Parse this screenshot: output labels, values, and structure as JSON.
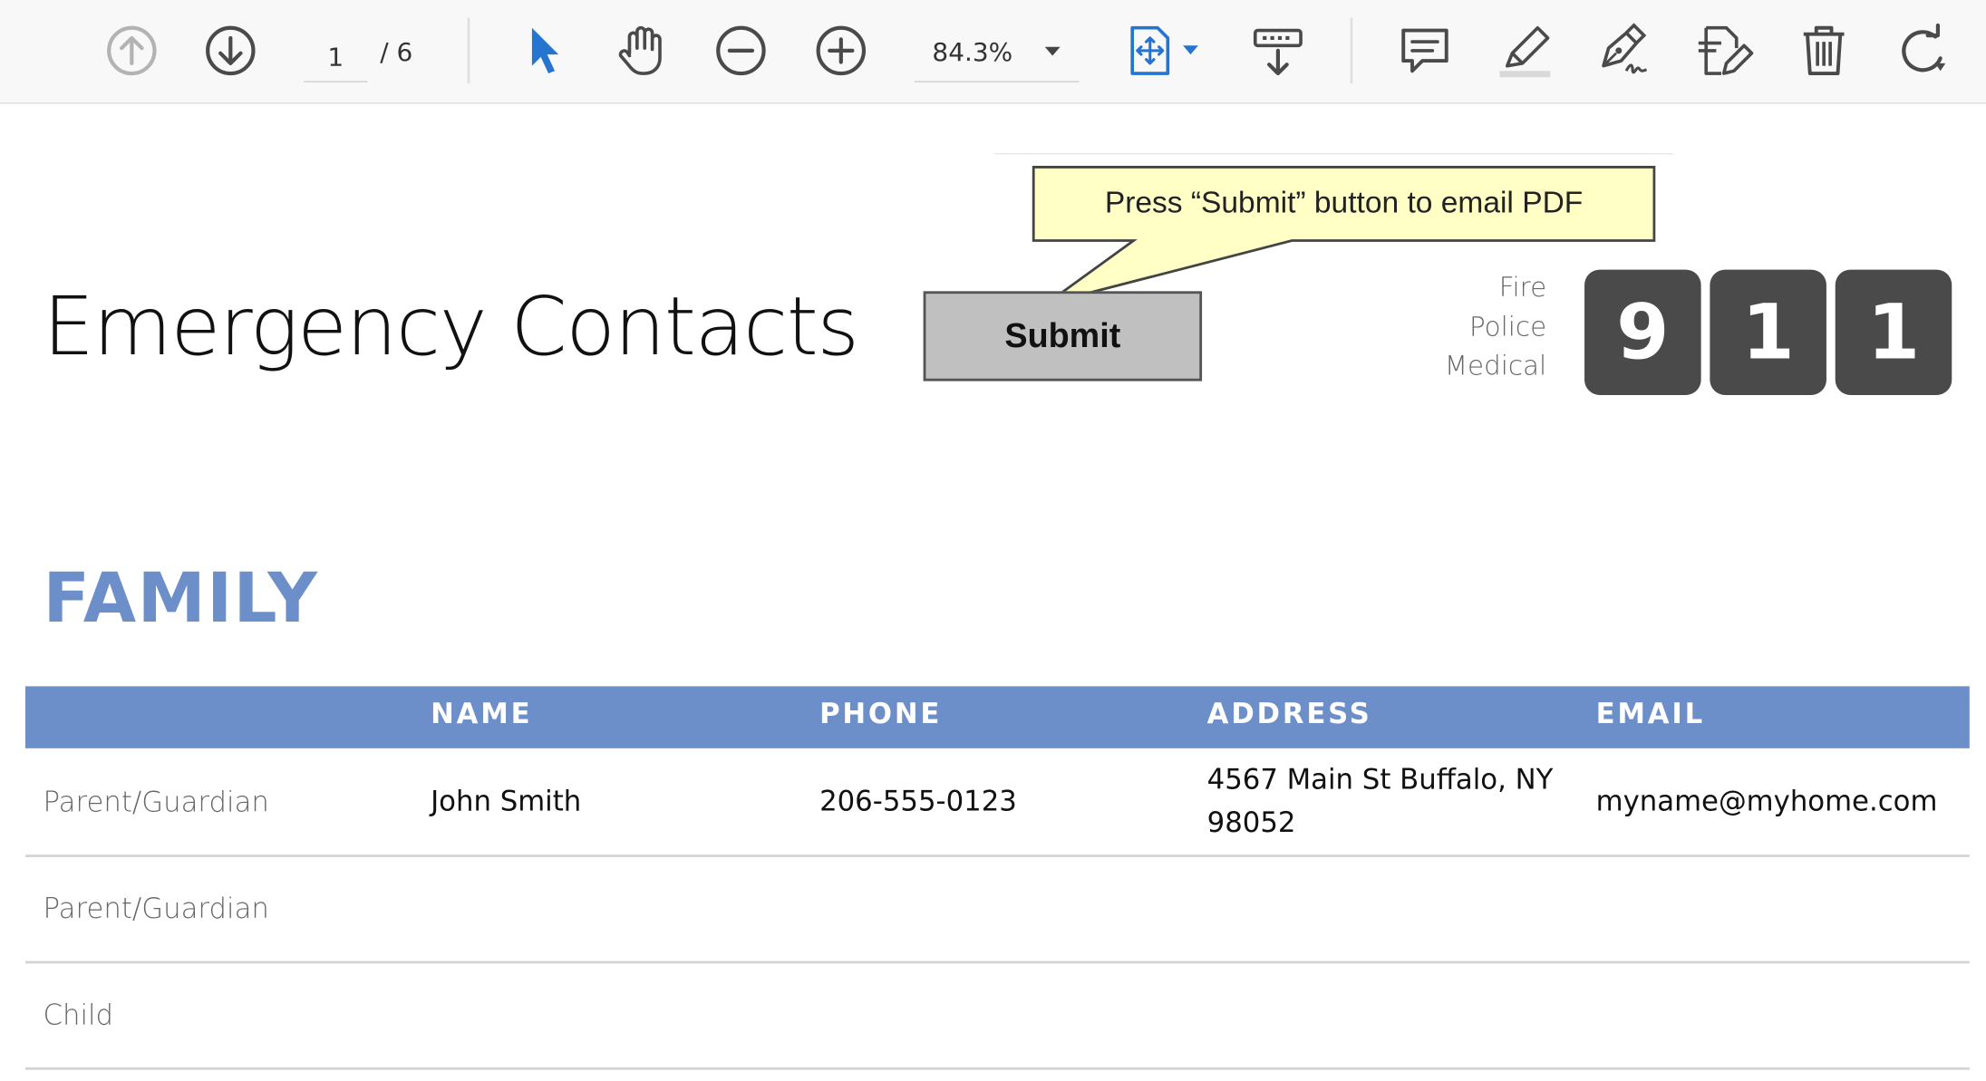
{
  "toolbar": {
    "page_current": "1",
    "page_total": "/ 6",
    "zoom": "84.3%",
    "icons": [
      "previous-page-icon",
      "next-page-icon",
      "select-arrow-icon",
      "hand-tool-icon",
      "zoom-out-icon",
      "zoom-in-icon",
      "fit-page-icon",
      "scroll-mode-icon",
      "comment-icon",
      "highlight-icon",
      "sign-icon",
      "edit-pdf-icon",
      "delete-icon",
      "rotate-icon"
    ]
  },
  "document": {
    "title": "Emergency Contacts",
    "submit_label": "Submit",
    "callout_text": "Press “Submit” button to email PDF",
    "services": [
      "Fire",
      "Police",
      "Medical"
    ],
    "emergency_number": [
      "9",
      "1",
      "1"
    ],
    "section_title": "FAMILY",
    "table": {
      "headers": [
        "NAME",
        "PHONE",
        "ADDRESS",
        "EMAIL"
      ],
      "rows": [
        {
          "label": "Parent/Guardian",
          "name": "John Smith",
          "phone": "206-555-0123",
          "address_line1": "4567 Main St Buffalo, NY",
          "address_line2": "98052",
          "email": "myname@myhome.com"
        },
        {
          "label": "Parent/Guardian",
          "name": "",
          "phone": "",
          "address_line1": "",
          "address_line2": "",
          "email": ""
        },
        {
          "label": "Child",
          "name": "",
          "phone": "",
          "address_line1": "",
          "address_line2": "",
          "email": ""
        }
      ]
    }
  },
  "colors": {
    "accent_blue": "#6d8fc9",
    "digit_tile": "#4a4a4a",
    "callout_fill": "#ffffc6",
    "submit_fill": "#c0c0c0"
  }
}
